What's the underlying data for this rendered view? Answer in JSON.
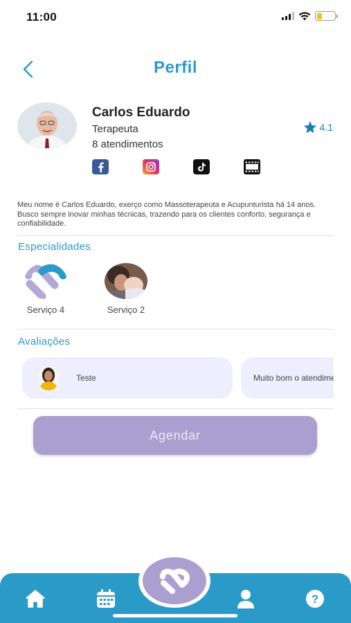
{
  "status": {
    "time": "11:00",
    "battery_level": 0.3
  },
  "header": {
    "title": "Perfil"
  },
  "profile": {
    "name": "Carlos Eduardo",
    "role": "Terapeuta",
    "appointments": "8 atendimentos",
    "rating": "4.1",
    "socials": [
      "facebook-icon",
      "instagram-icon",
      "tiktok-icon",
      "video-icon"
    ]
  },
  "bio": "Meu nome é Carlos Eduardo, exerço como Massoterapeuta e Acupunturista há 14 anos. Busco sempre inovar minhas técnicas, trazendo para os clientes conforto, segurança e confiabilidade.",
  "specialties": {
    "title": "Especialidades",
    "items": [
      {
        "label": "Serviço 4",
        "icon": "service-logo"
      },
      {
        "label": "Serviço 2",
        "icon": "service-photo"
      }
    ]
  },
  "reviews": {
    "title": "Avaliações",
    "items": [
      {
        "text": "Teste"
      },
      {
        "text": "Muito bom o atendimento"
      }
    ]
  },
  "cta": {
    "label": "Agendar"
  },
  "nav": {
    "items": [
      "home-icon",
      "calendar-icon",
      "brand-icon",
      "user-icon",
      "help-icon"
    ]
  },
  "colors": {
    "primary": "#2a9ac9",
    "accent": "#a9a0cf",
    "card": "#efeefe"
  }
}
